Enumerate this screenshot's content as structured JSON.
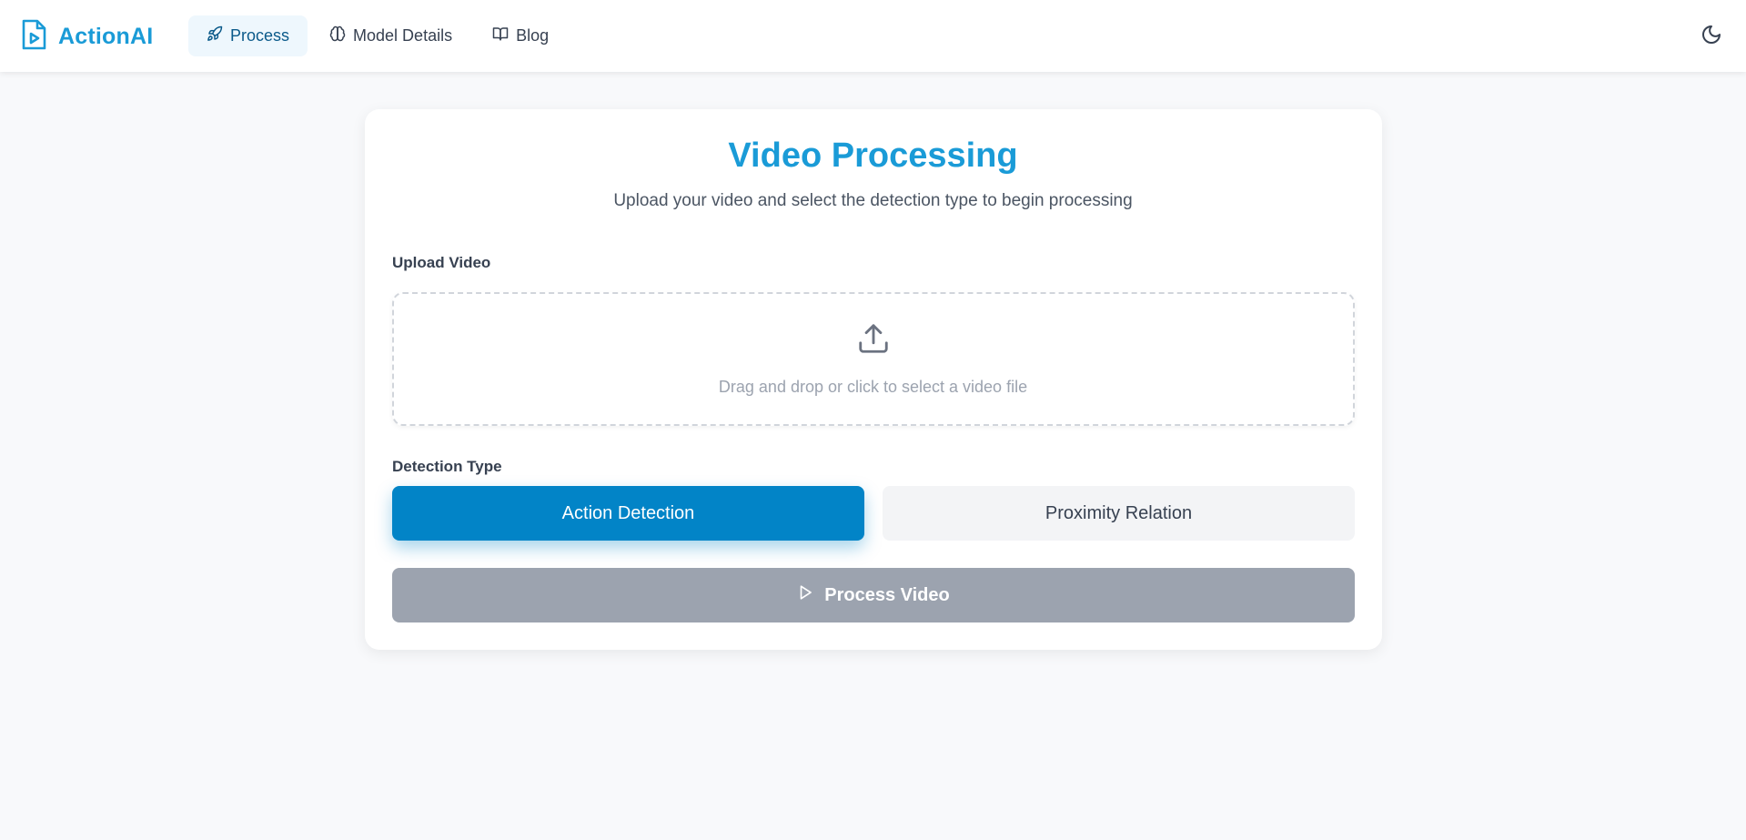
{
  "header": {
    "brand": "ActionAI",
    "nav": [
      {
        "label": "Process",
        "icon": "rocket-icon",
        "active": true
      },
      {
        "label": "Model Details",
        "icon": "brain-icon",
        "active": false
      },
      {
        "label": "Blog",
        "icon": "book-icon",
        "active": false
      }
    ],
    "theme_icon": "moon-icon"
  },
  "main": {
    "title": "Video Processing",
    "subtitle": "Upload your video and select the detection type to begin processing",
    "upload_label": "Upload Video",
    "upload_hint": "Drag and drop or click to select a video file",
    "detection_label": "Detection Type",
    "detection_options": [
      {
        "label": "Action Detection",
        "selected": true
      },
      {
        "label": "Proximity Relation",
        "selected": false
      }
    ],
    "process_button": "Process Video"
  },
  "colors": {
    "brand": "#1a9bd7",
    "selected_button": "#0284c7",
    "disabled_button": "#9ca3af",
    "background": "#f8f9fb"
  }
}
